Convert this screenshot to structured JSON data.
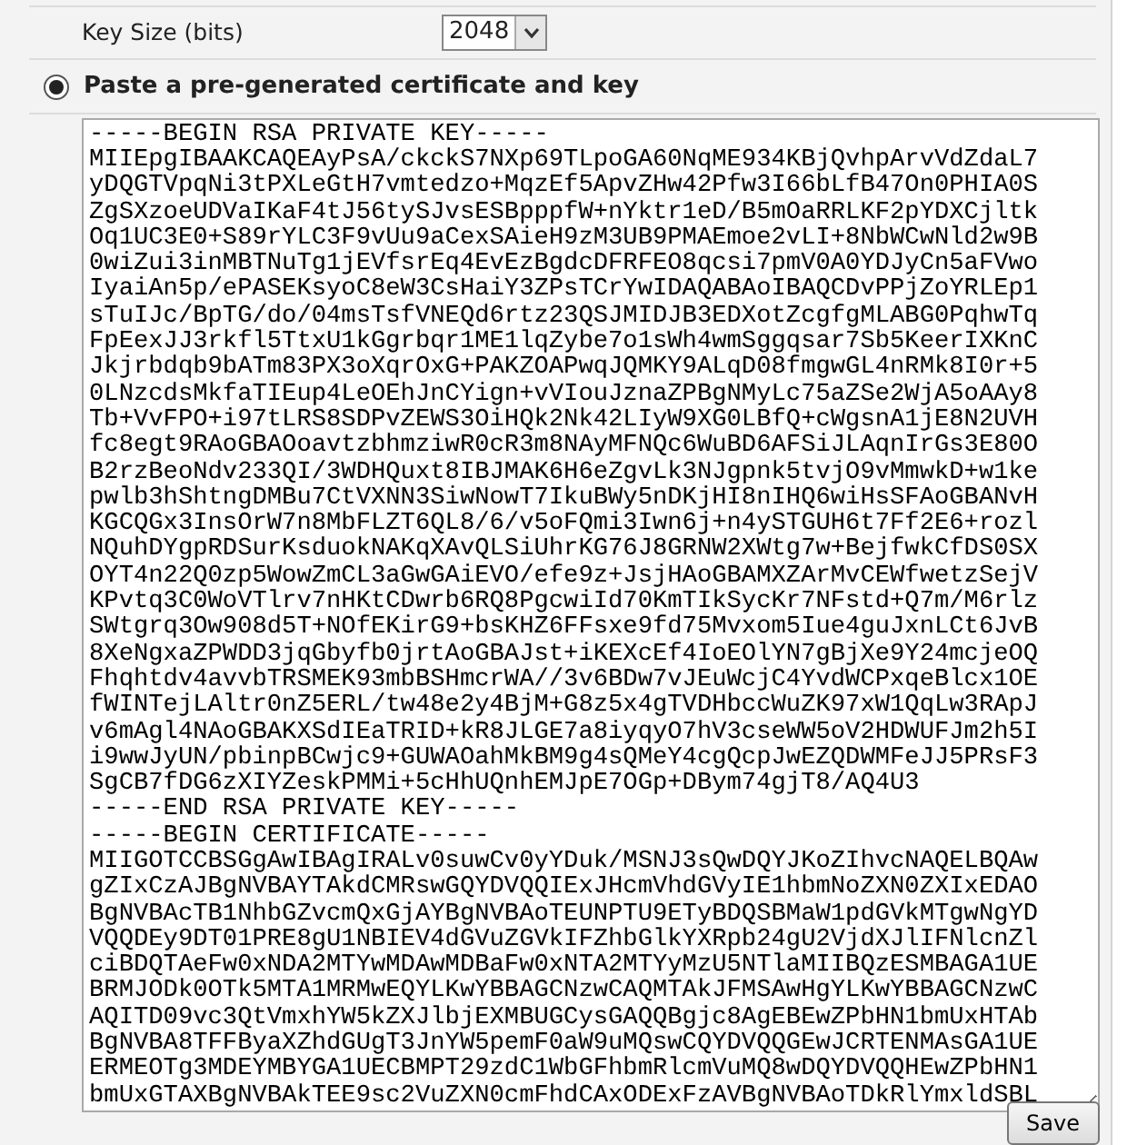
{
  "key_size": {
    "label": "Key Size (bits)",
    "value": "2048"
  },
  "paste_option": {
    "label": "Paste a pre-generated certificate and key",
    "selected": true
  },
  "certificate_text": [
    "-----BEGIN RSA PRIVATE KEY-----",
    "MIIEpgIBAAKCAQEAyPsA/ckckS7NXp69TLpoGA60NqME934KBjQvhpArvVdZdaL7",
    "yDQGTVpqNi3tPXLeGtH7vmtedzo+MqzEf5ApvZHw42Pfw3I66bLfB47On0PHIA0S",
    "ZgSXzoeUDVaIKaF4tJ56tySJvsESBpppfW+nYktr1eD/B5mOaRRLKF2pYDXCjltk",
    "Oq1UC3E0+S89rYLC3F9vUu9aCexSAieH9zM3UB9PMAEmoe2vLI+8NbWCwNld2w9B",
    "0wiZui3inMBTNuTg1jEVfsrEq4EvEzBgdcDFRFEO8qcsi7pmV0A0YDJyCn5aFVwo",
    "IyaiAn5p/ePASEKsyoC8eW3CsHaiY3ZPsTCrYwIDAQABAoIBAQCDvPPjZoYRLEp1",
    "sTuIJc/BpTG/do/04msTsfVNEQd6rtz23QSJMIDJB3EDXotZcgfgMLABG0PqhwTq",
    "FpEexJJ3rkfl5TtxU1kGgrbqr1ME1lqZybe7o1sWh4wmSggqsar7Sb5KeerIXKnC",
    "Jkjrbdqb9bATm83PX3oXqrOxG+PAKZOAPwqJQMKY9ALqD08fmgwGL4nRMk8I0r+5",
    "0LNzcdsMkfaTIEup4LeOEhJnCYign+vVIouJznaZPBgNMyLc75aZSe2WjA5oAAy8",
    "Tb+VvFPO+i97tLRS8SDPvZEWS3OiHQk2Nk42LIyW9XG0LBfQ+cWgsnA1jE8N2UVH",
    "fc8egt9RAoGBAOoavtzbhmziwR0cR3m8NAyMFNQc6WuBD6AFSiJLAqnIrGs3E80O",
    "B2rzBeoNdv233QI/3WDHQuxt8IBJMAK6H6eZgvLk3NJgpnk5tvjO9vMmwkD+w1ke",
    "pwlb3hShtngDMBu7CtVXNN3SiwNowT7IkuBWy5nDKjHI8nIHQ6wiHsSFAoGBANvH",
    "KGCQGx3InsOrW7n8MbFLZT6QL8/6/v5oFQmi3Iwn6j+n4ySTGUH6t7Ff2E6+rozl",
    "NQuhDYgpRDSurKsduokNAKqXAvQLSiUhrKG76J8GRNW2XWtg7w+BejfwkCfDS0SX",
    "OYT4n22Q0zp5WowZmCL3aGwGAiEVO/efe9z+JsjHAoGBAMXZArMvCEWfwetzSejV",
    "KPvtq3C0WoVTlrv7nHKtCDwrb6RQ8PgcwiId70KmTIkSycKr7NFstd+Q7m/M6rlz",
    "SWtgrq3Ow908d5T+NOfEKirG9+bsKHZ6FFsxe9fd75Mvxom5Iue4guJxnLCt6JvB",
    "8XeNgxaZPWDD3jqGbyfb0jrtAoGBAJst+iKEXcEf4IoEOlYN7gBjXe9Y24mcjeOQ",
    "Fhqhtdv4avvbTRSMEK93mbBSHmcrWA//3v6BDw7vJEuWcjC4YvdWCPxqeBlcx1OE",
    "fWINTejLAltr0nZ5ERL/tw48e2y4BjM+G8z5x4gTVDHbccWuZK97xW1QqLw3RApJ",
    "v6mAgl4NAoGBAKXSdIEaTRID+kR8JLGE7a8iyqyO7hV3cseWW5oV2HDWUFJm2h5I",
    "i9wwJyUN/pbinpBCwjc9+GUWAOahMkBM9g4sQMeY4cgQcpJwEZQDWMFeJJ5PRsF3",
    "SgCB7fDG6zXIYZeskPMMi+5cHhUQnhEMJpE7OGp+DBym74gjT8/AQ4U3",
    "-----END RSA PRIVATE KEY-----",
    "-----BEGIN CERTIFICATE-----",
    "MIIGOTCCBSGgAwIBAgIRALv0suwCv0yYDuk/MSNJ3sQwDQYJKoZIhvcNAQELBQAw",
    "gZIxCzAJBgNVBAYTAkdCMRswGQYDVQQIExJHcmVhdGVyIE1hbmNoZXN0ZXIxEDAO",
    "BgNVBAcTB1NhbGZvcmQxGjAYBgNVBAoTEUNPTU9ETyBDQSBMaW1pdGVkMTgwNgYD",
    "VQQDEy9DT01PRE8gU1NBIEV4dGVuZGVkIFZhbGlkYXRpb24gU2VjdXJlIFNlcnZl",
    "ciBDQTAeFw0xNDA2MTYwMDAwMDBaFw0xNTA2MTYyMzU5NTlaMIIBQzESMBAGA1UE",
    "BRMJODk0OTk5MTA1MRMwEQYLKwYBBAGCNzwCAQMTAkJFMSAwHgYLKwYBBAGCNzwC",
    "AQITD09vc3QtVmxhYW5kZXJlbjEXMBUGCysGAQQBgjc8AgEBEwZPbHN1bmUxHTAb",
    "BgNVBA8TFFByaXZhdGUgT3JnYW5pemF0aW9uMQswCQYDVQQGEwJCRTENMAsGA1UE",
    "ERMEOTg3MDEYMBYGA1UECBMPT29zdC1WbGFhbmRlcmVuMQ8wDQYDVQQHEwZPbHN1",
    "bmUxGTAXBgNVBAkTEE9sc2VuZXN0cmFhdCAxODExFzAVBgNVBAoTDkRlYmxldSBL"
  ],
  "save_button": {
    "label": "Save"
  }
}
